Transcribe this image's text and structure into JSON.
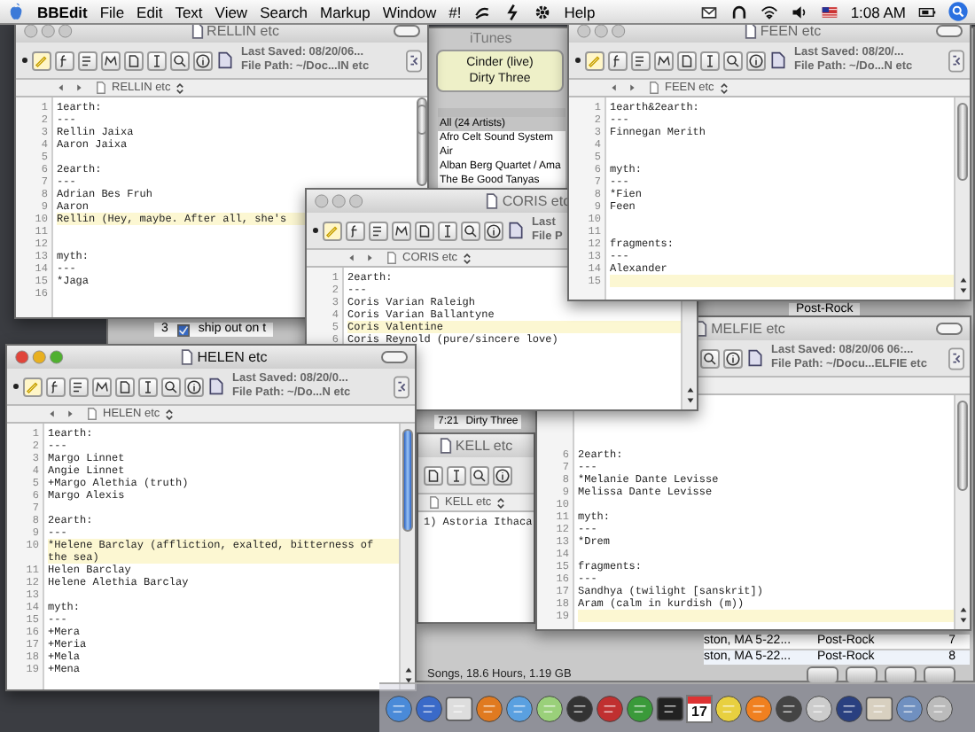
{
  "menubar": {
    "app": "BBEdit",
    "menus": [
      "File",
      "Edit",
      "Text",
      "View",
      "Search",
      "Markup",
      "Window",
      "#!"
    ],
    "help": "Help",
    "clock": "1:08 AM"
  },
  "itunes": {
    "title": "iTunes",
    "now_playing": [
      "Cinder (live)",
      "Dirty Three"
    ],
    "browser": [
      {
        "label": "All (24 Artists)",
        "selected": true
      },
      {
        "label": "Afro Celt Sound System",
        "selected": false
      },
      {
        "label": "Air",
        "selected": false
      },
      {
        "label": "Alban Berg Quartet / Ama",
        "selected": false
      },
      {
        "label": "The Be Good Tanyas",
        "selected": false
      }
    ],
    "track_row": {
      "number": "3",
      "checked": true,
      "name": "ship out on t"
    },
    "time_row": {
      "time": "7:21",
      "artist": "Dirty Three"
    },
    "genre_rows": [
      {
        "genre": "Post-Rock"
      },
      {
        "location": "ston, MA 5-22...",
        "genre": "Post-Rock",
        "count": "7"
      },
      {
        "location": "ston, MA 5-22...",
        "genre": "Post-Rock",
        "count": "8"
      }
    ],
    "status": "Songs, 18.6 Hours, 1.19 GB"
  },
  "windows": [
    {
      "title": "RELLIN etc",
      "active": false,
      "last_saved": "Last Saved: 08/20/06...",
      "file_path": "File Path: ~/Doc...IN etc",
      "tab": "RELLIN etc",
      "lines": [
        {
          "n": "1",
          "text": "1earth:",
          "highlighted": false
        },
        {
          "n": "2",
          "text": "---",
          "highlighted": false
        },
        {
          "n": "3",
          "text": "Rellin Jaixa",
          "highlighted": false
        },
        {
          "n": "4",
          "text": "Aaron Jaixa",
          "highlighted": false
        },
        {
          "n": "5",
          "highlighted": false
        },
        {
          "n": "6",
          "text": "2earth:",
          "highlighted": false
        },
        {
          "n": "7",
          "text": "---",
          "highlighted": false
        },
        {
          "n": "8",
          "text": "Adrian Bes Fruh",
          "highlighted": false
        },
        {
          "n": "9",
          "text": "Aaron",
          "highlighted": false
        },
        {
          "n": "10",
          "text": "Rellin (Hey, maybe. After all, she's",
          "highlighted": true
        },
        {
          "n": "11",
          "highlighted": false
        },
        {
          "n": "12",
          "highlighted": false
        },
        {
          "n": "13",
          "text": "myth:",
          "highlighted": false
        },
        {
          "n": "14",
          "text": "---",
          "highlighted": false
        },
        {
          "n": "15",
          "text": "*Jaga",
          "highlighted": false
        },
        {
          "n": "16",
          "highlighted": false
        }
      ]
    },
    {
      "title": "KELL etc",
      "active": false,
      "tab": "KELL etc",
      "lines": [
        {
          "text": "1) Astoria Ithaca",
          "highlighted": false
        }
      ]
    },
    {
      "title": "MELFIE etc",
      "active": false,
      "last_saved": "Last Saved: 08/20/06 06:...",
      "file_path": "File Path: ~/Docu...ELFIE etc",
      "lines": [
        {
          "n": "6",
          "text": "2earth:",
          "highlighted": false
        },
        {
          "n": "7",
          "text": "---",
          "highlighted": false
        },
        {
          "n": "8",
          "text": "*Melanie Dante Levisse",
          "highlighted": false
        },
        {
          "n": "9",
          "text": "Melissa Dante Levisse",
          "highlighted": false
        },
        {
          "n": "10",
          "highlighted": false
        },
        {
          "n": "11",
          "text": "myth:",
          "highlighted": false
        },
        {
          "n": "12",
          "text": "---",
          "highlighted": false
        },
        {
          "n": "13",
          "text": "*Drem",
          "highlighted": false
        },
        {
          "n": "14",
          "highlighted": false
        },
        {
          "n": "15",
          "text": "fragments:",
          "highlighted": false
        },
        {
          "n": "16",
          "text": "---",
          "highlighted": false
        },
        {
          "n": "17",
          "text": "Sandhya (twilight [sanskrit])",
          "highlighted": false
        },
        {
          "n": "18",
          "text": "Aram (calm in kurdish (m))",
          "highlighted": false
        },
        {
          "n": "19",
          "highlighted": true
        }
      ]
    },
    {
      "title": "CORIS etc",
      "active": false,
      "last_saved": "Last",
      "file_path": "File P",
      "tab": "CORIS etc",
      "lines": [
        {
          "n": "1",
          "text": "2earth:",
          "highlighted": false
        },
        {
          "n": "2",
          "text": "---",
          "highlighted": false
        },
        {
          "n": "3",
          "text": "Coris Varian Raleigh",
          "highlighted": false
        },
        {
          "n": "4",
          "text": "Coris Varian Ballantyne",
          "highlighted": false
        },
        {
          "n": "5",
          "text": "Coris Valentine",
          "highlighted": true
        },
        {
          "n": "6",
          "text": "Coris Reynold (pure/sincere love)",
          "highlighted": false
        }
      ]
    },
    {
      "title": "FEEN etc",
      "active": false,
      "last_saved": "Last Saved: 08/20/...",
      "file_path": "File Path: ~/Do...N etc",
      "tab": "FEEN etc",
      "lines": [
        {
          "n": "1",
          "text": "1earth&2earth:",
          "highlighted": false
        },
        {
          "n": "2",
          "text": "---",
          "highlighted": false
        },
        {
          "n": "3",
          "text": "Finnegan Merith",
          "highlighted": false
        },
        {
          "n": "4",
          "highlighted": false
        },
        {
          "n": "5",
          "highlighted": false
        },
        {
          "n": "6",
          "text": "myth:",
          "highlighted": false
        },
        {
          "n": "7",
          "text": "---",
          "highlighted": false
        },
        {
          "n": "8",
          "text": "*Fien",
          "highlighted": false
        },
        {
          "n": "9",
          "text": "Feen",
          "highlighted": false
        },
        {
          "n": "10",
          "highlighted": false
        },
        {
          "n": "11",
          "highlighted": false
        },
        {
          "n": "12",
          "text": "fragments:",
          "highlighted": false
        },
        {
          "n": "13",
          "text": "---",
          "highlighted": false
        },
        {
          "n": "14",
          "text": "Alexander",
          "highlighted": false
        },
        {
          "n": "15",
          "highlighted": true
        }
      ]
    },
    {
      "title": "HELEN etc",
      "active": true,
      "last_saved": "Last Saved: 08/20/0...",
      "file_path": "File Path: ~/Do...N etc",
      "tab": "HELEN etc",
      "lines": [
        {
          "n": "1",
          "text": "1earth:",
          "highlighted": false
        },
        {
          "n": "2",
          "text": "---",
          "highlighted": false
        },
        {
          "n": "3",
          "text": "Margo Linnet",
          "highlighted": false
        },
        {
          "n": "4",
          "text": "Angie Linnet",
          "highlighted": false
        },
        {
          "n": "5",
          "text": "+Margo Alethia (truth)",
          "highlighted": false
        },
        {
          "n": "6",
          "text": "Margo Alexis",
          "highlighted": false
        },
        {
          "n": "7",
          "highlighted": false
        },
        {
          "n": "8",
          "text": "2earth:",
          "highlighted": false
        },
        {
          "n": "9",
          "text": "---",
          "highlighted": false
        },
        {
          "n": "10",
          "text": "*Helene Barclay (affliction, exalted, bitterness of the sea)",
          "highlighted": true
        },
        {
          "n": "11",
          "text": "Helen Barclay",
          "highlighted": false
        },
        {
          "n": "12",
          "text": "Helene Alethia Barclay",
          "highlighted": false
        },
        {
          "n": "13",
          "highlighted": false
        },
        {
          "n": "14",
          "text": "myth:",
          "highlighted": false
        },
        {
          "n": "15",
          "text": "---",
          "highlighted": false
        },
        {
          "n": "16",
          "text": "+Mera",
          "highlighted": false
        },
        {
          "n": "17",
          "text": "+Meria",
          "highlighted": false
        },
        {
          "n": "18",
          "text": "+Mela",
          "highlighted": false
        },
        {
          "n": "19",
          "text": "+Mena",
          "highlighted": false
        }
      ]
    }
  ],
  "dock": {
    "calendar_day": "17"
  }
}
